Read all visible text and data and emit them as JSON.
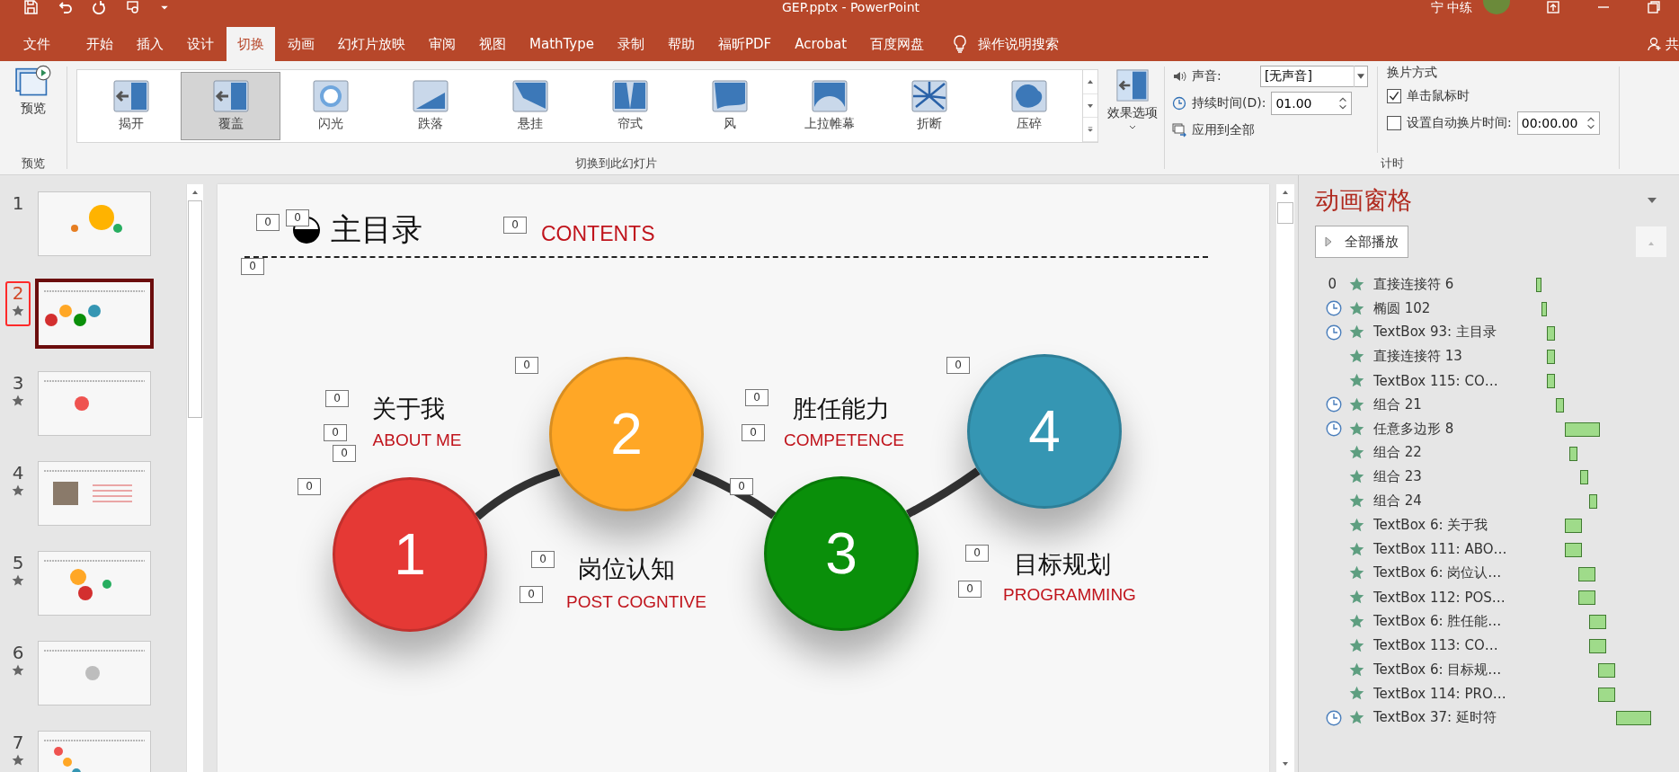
{
  "window": {
    "title": "GEP.pptx  -  PowerPoint",
    "user": "宁 中练"
  },
  "tabs": [
    {
      "label": "文件",
      "selected": false
    },
    {
      "label": "开始",
      "selected": false
    },
    {
      "label": "插入",
      "selected": false
    },
    {
      "label": "设计",
      "selected": false
    },
    {
      "label": "切换",
      "selected": true
    },
    {
      "label": "动画",
      "selected": false
    },
    {
      "label": "幻灯片放映",
      "selected": false
    },
    {
      "label": "审阅",
      "selected": false
    },
    {
      "label": "视图",
      "selected": false
    },
    {
      "label": "MathType",
      "selected": false
    },
    {
      "label": "录制",
      "selected": false
    },
    {
      "label": "帮助",
      "selected": false
    },
    {
      "label": "福昕PDF",
      "selected": false
    },
    {
      "label": "Acrobat",
      "selected": false
    },
    {
      "label": "百度网盘",
      "selected": false
    }
  ],
  "tell_me": "操作说明搜索",
  "share": "共",
  "ribbon": {
    "preview": {
      "button": "预览",
      "group": "预览"
    },
    "transitions": [
      {
        "label": "揭开",
        "selected": false
      },
      {
        "label": "覆盖",
        "selected": true
      },
      {
        "label": "闪光",
        "selected": false
      },
      {
        "label": "跌落",
        "selected": false
      },
      {
        "label": "悬挂",
        "selected": false
      },
      {
        "label": "帘式",
        "selected": false
      },
      {
        "label": "风",
        "selected": false
      },
      {
        "label": "上拉帷幕",
        "selected": false
      },
      {
        "label": "折断",
        "selected": false
      },
      {
        "label": "压碎",
        "selected": false
      }
    ],
    "effect_options": "效果选项",
    "transitions_group": "切换到此幻灯片",
    "sound_label": "声音:",
    "sound_value": "[无声音]",
    "duration_label": "持续时间(D):",
    "duration_value": "01.00",
    "apply_all": "应用到全部",
    "advance_title": "换片方式",
    "on_click": {
      "label": "单击鼠标时",
      "checked": true
    },
    "after": {
      "label": "设置自动换片时间:",
      "checked": false,
      "value": "00:00.00"
    },
    "timing_group": "计时"
  },
  "slides": [
    {
      "number": "1",
      "selected": false,
      "animated": false
    },
    {
      "number": "2",
      "selected": true,
      "animated": true
    },
    {
      "number": "3",
      "selected": false,
      "animated": true
    },
    {
      "number": "4",
      "selected": false,
      "animated": true
    },
    {
      "number": "5",
      "selected": false,
      "animated": true
    },
    {
      "number": "6",
      "selected": false,
      "animated": true
    },
    {
      "number": "7",
      "selected": false,
      "animated": true
    }
  ],
  "slide": {
    "title": "主目录",
    "title_en": "CONTENTS",
    "steps": [
      {
        "number": "1",
        "title": "关于我",
        "subtitle": "ABOUT ME",
        "color": "#e53935"
      },
      {
        "number": "2",
        "title": "岗位认知",
        "subtitle": "POST COGNTIVE",
        "color": "#ffa726"
      },
      {
        "number": "3",
        "title": "胜任能力",
        "subtitle": "COMPETENCE",
        "color": "#0a8f0a"
      },
      {
        "number": "4",
        "title": "目标规划",
        "subtitle": "PROGRAMMING",
        "color": "#3596b3"
      }
    ],
    "animation_tags": [
      "0",
      "0",
      "0",
      "0",
      "0",
      "0",
      "0",
      "0",
      "0",
      "0",
      "0",
      "0",
      "0",
      "0",
      "0",
      "0",
      "0"
    ]
  },
  "animation_pane": {
    "title": "动画窗格",
    "play_all": "全部播放",
    "items": [
      {
        "kind": "click",
        "number": "0",
        "label": "直接连接符 6"
      },
      {
        "kind": "after",
        "label": "椭圆 102"
      },
      {
        "kind": "after",
        "label": "TextBox 93: 主目录"
      },
      {
        "kind": "with",
        "label": "直接连接符 13"
      },
      {
        "kind": "with",
        "label": "TextBox 115: CO…"
      },
      {
        "kind": "after",
        "label": "组合 21"
      },
      {
        "kind": "after",
        "label": "任意多边形 8"
      },
      {
        "kind": "with",
        "label": "组合 22"
      },
      {
        "kind": "with",
        "label": "组合 23"
      },
      {
        "kind": "with",
        "label": "组合 24"
      },
      {
        "kind": "with",
        "label": "TextBox 6: 关于我"
      },
      {
        "kind": "with",
        "label": "TextBox 111: ABO…"
      },
      {
        "kind": "with",
        "label": "TextBox 6: 岗位认…"
      },
      {
        "kind": "with",
        "label": "TextBox 112: POS…"
      },
      {
        "kind": "with",
        "label": "TextBox 6: 胜任能…"
      },
      {
        "kind": "with",
        "label": "TextBox 113: CO…"
      },
      {
        "kind": "with",
        "label": "TextBox 6: 目标规…"
      },
      {
        "kind": "with",
        "label": "TextBox 114: PRO…"
      },
      {
        "kind": "after",
        "label": "TextBox 37: 延时符"
      }
    ]
  }
}
